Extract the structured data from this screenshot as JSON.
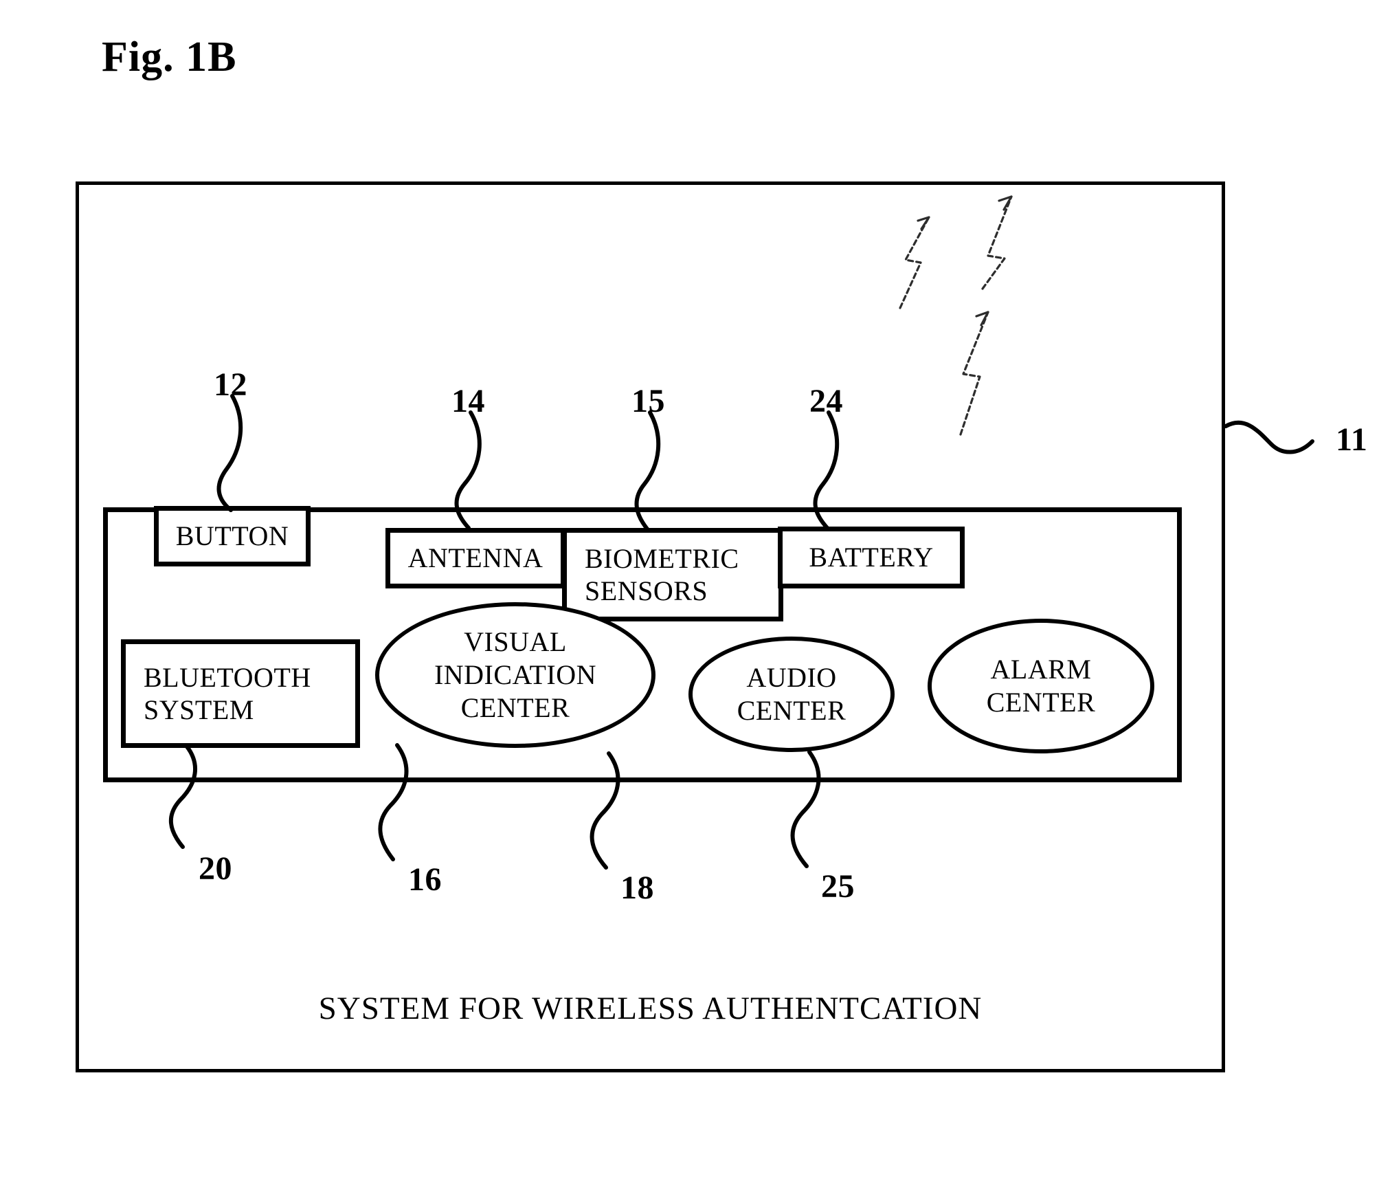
{
  "figure": {
    "title": "Fig. 1B",
    "caption": "SYSTEM FOR WIRELESS AUTHENTCATION"
  },
  "colors": {
    "stroke": "#000000",
    "background": "#ffffff"
  },
  "nodes": [
    {
      "id": "button",
      "label": "BUTTON",
      "shape": "rect",
      "ref": "12"
    },
    {
      "id": "antenna",
      "label": "ANTENNA",
      "shape": "rect",
      "ref": "14"
    },
    {
      "id": "biometric",
      "label": "BIOMETRIC\nSENSORS",
      "shape": "rect",
      "ref": "15"
    },
    {
      "id": "battery",
      "label": "BATTERY",
      "shape": "rect",
      "ref": "24"
    },
    {
      "id": "bluetooth",
      "label": "BLUETOOTH\nSYSTEM",
      "shape": "rect",
      "ref": "20"
    },
    {
      "id": "visual",
      "label": "VISUAL\nINDICATION\nCENTER",
      "shape": "ellipse",
      "ref": "16"
    },
    {
      "id": "audio",
      "label": "AUDIO\nCENTER",
      "shape": "ellipse",
      "ref": "18"
    },
    {
      "id": "alarm",
      "label": "ALARM\nCENTER",
      "shape": "ellipse",
      "ref": "25"
    }
  ],
  "container": {
    "ref": "11",
    "label": "system-enclosure"
  },
  "reference_numerals": {
    "button": "12",
    "antenna": "14",
    "biometric": "15",
    "battery": "24",
    "enclosure": "11",
    "bluetooth": "20",
    "visual": "16",
    "audio": "18",
    "alarm": "25"
  },
  "annotations": {
    "wireless_signal_icons": 3
  }
}
